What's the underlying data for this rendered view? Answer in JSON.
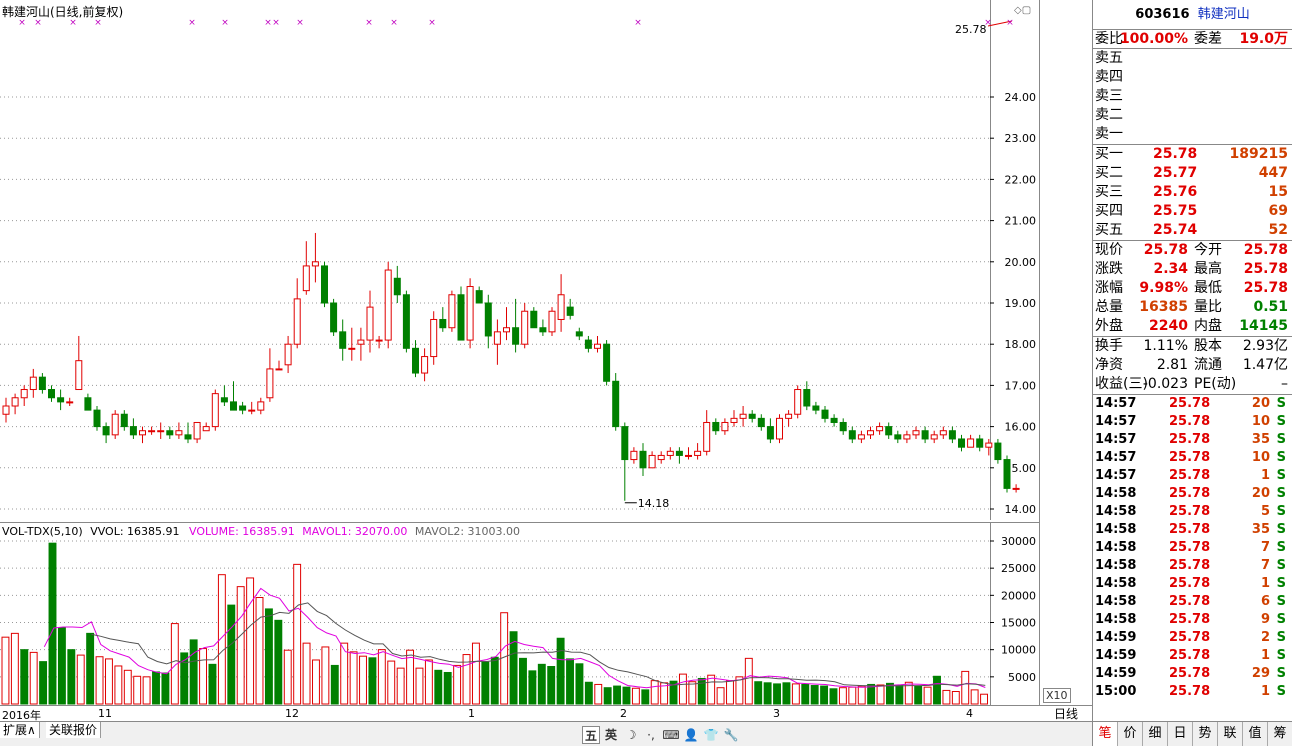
{
  "price_pane": {
    "title": "韩建河山(日线,前复权)",
    "high_label": "25.78",
    "low_label": "14.18",
    "y_ticks": [
      "24.00",
      "23.00",
      "22.00",
      "21.00",
      "20.00",
      "19.00",
      "18.00",
      "17.00",
      "16.00",
      "15.00",
      "14.00"
    ]
  },
  "volume_pane": {
    "indicator": "VOL-TDX(5,10)",
    "vvol": "VVOL: 16385.91",
    "volume": "VOLUME: 16385.91",
    "mavol1": "MAVOL1: 32070.00",
    "mavol2": "MAVOL2: 31003.00",
    "y_ticks": [
      "30000",
      "25000",
      "20000",
      "15000",
      "10000",
      "5000"
    ],
    "scale_label": "X10"
  },
  "x_axis": {
    "labels": [
      "2016年",
      "11",
      "12",
      "1",
      "2",
      "3",
      "4"
    ],
    "period": "日线"
  },
  "bottom_tabs": [
    "扩展∧",
    "关联报价"
  ],
  "toolbar_icons": [
    "五",
    "英",
    "☽",
    "·,",
    "⌨",
    "👤",
    "👕",
    "🔧"
  ],
  "quote": {
    "code": "603616",
    "name": "韩建河山",
    "weibi_label": "委比",
    "weibi_value": "100.00%",
    "weicha_label": "委差",
    "weicha_value": "19.0万",
    "sells": [
      {
        "label": "卖五",
        "price": "",
        "vol": ""
      },
      {
        "label": "卖四",
        "price": "",
        "vol": ""
      },
      {
        "label": "卖三",
        "price": "",
        "vol": ""
      },
      {
        "label": "卖二",
        "price": "",
        "vol": ""
      },
      {
        "label": "卖一",
        "price": "",
        "vol": ""
      }
    ],
    "buys": [
      {
        "label": "买一",
        "price": "25.78",
        "vol": "189215"
      },
      {
        "label": "买二",
        "price": "25.77",
        "vol": "447"
      },
      {
        "label": "买三",
        "price": "25.76",
        "vol": "15"
      },
      {
        "label": "买四",
        "price": "25.75",
        "vol": "69"
      },
      {
        "label": "买五",
        "price": "25.74",
        "vol": "52"
      }
    ],
    "stats": [
      {
        "l1": "现价",
        "v1": "25.78",
        "l2": "今开",
        "v2": "25.78",
        "c1": "red",
        "c2": "red"
      },
      {
        "l1": "涨跌",
        "v1": "2.34",
        "l2": "最高",
        "v2": "25.78",
        "c1": "red",
        "c2": "red"
      },
      {
        "l1": "涨幅",
        "v1": "9.98%",
        "l2": "最低",
        "v2": "25.78",
        "c1": "red",
        "c2": "red"
      },
      {
        "l1": "总量",
        "v1": "16385",
        "l2": "量比",
        "v2": "0.51",
        "c1": "orange",
        "c2": "green"
      },
      {
        "l1": "外盘",
        "v1": "2240",
        "l2": "内盘",
        "v2": "14145",
        "c1": "red",
        "c2": "green"
      }
    ],
    "fundamentals": [
      {
        "l1": "换手",
        "v1": "1.11%",
        "l2": "股本",
        "v2": "2.93亿"
      },
      {
        "l1": "净资",
        "v1": "2.81",
        "l2": "流通",
        "v2": "1.47亿"
      },
      {
        "l1": "收益(三)",
        "v1": "-0.023",
        "l2": "PE(动)",
        "v2": "–"
      }
    ],
    "ticks": [
      {
        "time": "14:57",
        "price": "25.78",
        "vol": "20",
        "flag": "S"
      },
      {
        "time": "14:57",
        "price": "25.78",
        "vol": "10",
        "flag": "S"
      },
      {
        "time": "14:57",
        "price": "25.78",
        "vol": "35",
        "flag": "S"
      },
      {
        "time": "14:57",
        "price": "25.78",
        "vol": "10",
        "flag": "S"
      },
      {
        "time": "14:57",
        "price": "25.78",
        "vol": "1",
        "flag": "S"
      },
      {
        "time": "14:58",
        "price": "25.78",
        "vol": "20",
        "flag": "S"
      },
      {
        "time": "14:58",
        "price": "25.78",
        "vol": "5",
        "flag": "S"
      },
      {
        "time": "14:58",
        "price": "25.78",
        "vol": "35",
        "flag": "S"
      },
      {
        "time": "14:58",
        "price": "25.78",
        "vol": "7",
        "flag": "S"
      },
      {
        "time": "14:58",
        "price": "25.78",
        "vol": "7",
        "flag": "S"
      },
      {
        "time": "14:58",
        "price": "25.78",
        "vol": "1",
        "flag": "S"
      },
      {
        "time": "14:58",
        "price": "25.78",
        "vol": "6",
        "flag": "S"
      },
      {
        "time": "14:58",
        "price": "25.78",
        "vol": "9",
        "flag": "S"
      },
      {
        "time": "14:59",
        "price": "25.78",
        "vol": "2",
        "flag": "S"
      },
      {
        "time": "14:59",
        "price": "25.78",
        "vol": "1",
        "flag": "S"
      },
      {
        "time": "14:59",
        "price": "25.78",
        "vol": "29",
        "flag": "S"
      },
      {
        "time": "15:00",
        "price": "25.78",
        "vol": "1",
        "flag": "S"
      }
    ],
    "tabs": [
      "笔",
      "价",
      "细",
      "日",
      "势",
      "联",
      "值",
      "筹"
    ]
  },
  "colors": {
    "up": "#e00000",
    "down": "#008000",
    "ma1": "#e000e0",
    "ma2": "#555555",
    "grid": "#999999"
  },
  "chart_data": {
    "type": "candlestick",
    "title": "韩建河山(日线,前复权)",
    "ylim": [
      14.0,
      24.0
    ],
    "x_labels": [
      "2016年",
      "11",
      "12",
      "1",
      "2",
      "3",
      "4"
    ],
    "candles": [
      [
        16.3,
        16.7,
        16.1,
        16.5
      ],
      [
        16.5,
        16.8,
        16.3,
        16.7
      ],
      [
        16.7,
        17.0,
        16.5,
        16.9
      ],
      [
        16.9,
        17.4,
        16.7,
        17.2
      ],
      [
        17.2,
        17.3,
        16.8,
        16.9
      ],
      [
        16.9,
        17.0,
        16.6,
        16.7
      ],
      [
        16.7,
        16.9,
        16.4,
        16.6
      ],
      [
        16.6,
        16.7,
        16.5,
        16.6
      ],
      [
        16.9,
        18.2,
        16.9,
        17.6
      ],
      [
        16.7,
        16.8,
        16.4,
        16.4
      ],
      [
        16.4,
        16.5,
        15.9,
        16.0
      ],
      [
        16.0,
        16.1,
        15.6,
        15.8
      ],
      [
        15.8,
        16.4,
        15.7,
        16.3
      ],
      [
        16.3,
        16.4,
        15.9,
        16.0
      ],
      [
        16.0,
        16.2,
        15.7,
        15.8
      ],
      [
        15.8,
        16.0,
        15.6,
        15.9
      ],
      [
        15.9,
        16.0,
        15.8,
        15.9
      ],
      [
        15.9,
        16.1,
        15.7,
        15.9
      ],
      [
        15.9,
        16.0,
        15.7,
        15.8
      ],
      [
        15.8,
        16.1,
        15.7,
        15.9
      ],
      [
        15.8,
        16.1,
        15.6,
        15.7
      ],
      [
        15.7,
        16.1,
        15.6,
        16.1
      ],
      [
        15.9,
        16.1,
        15.9,
        16.0
      ],
      [
        16.0,
        16.9,
        15.9,
        16.8
      ],
      [
        16.7,
        17.0,
        16.5,
        16.6
      ],
      [
        16.6,
        17.1,
        16.4,
        16.4
      ],
      [
        16.5,
        16.6,
        16.3,
        16.4
      ],
      [
        16.4,
        16.6,
        16.3,
        16.4
      ],
      [
        16.4,
        16.7,
        16.3,
        16.6
      ],
      [
        16.7,
        17.9,
        16.6,
        17.4
      ],
      [
        17.4,
        17.6,
        17.4,
        17.4
      ],
      [
        17.5,
        18.2,
        17.3,
        18.0
      ],
      [
        18.0,
        19.6,
        17.9,
        19.1
      ],
      [
        19.3,
        20.5,
        19.2,
        19.9
      ],
      [
        19.9,
        20.7,
        19.5,
        20.0
      ],
      [
        19.9,
        20.0,
        18.9,
        19.0
      ],
      [
        19.0,
        19.1,
        18.2,
        18.3
      ],
      [
        18.3,
        18.6,
        17.6,
        17.9
      ],
      [
        17.9,
        18.4,
        17.6,
        17.9
      ],
      [
        18.0,
        18.4,
        17.6,
        18.1
      ],
      [
        18.1,
        19.3,
        17.8,
        18.9
      ],
      [
        18.1,
        18.2,
        17.9,
        18.1
      ],
      [
        18.1,
        20.0,
        17.9,
        19.8
      ],
      [
        19.6,
        19.9,
        19.0,
        19.2
      ],
      [
        19.2,
        19.3,
        17.8,
        17.9
      ],
      [
        17.9,
        18.1,
        17.2,
        17.3
      ],
      [
        17.3,
        17.9,
        17.1,
        17.7
      ],
      [
        17.7,
        18.8,
        17.5,
        18.6
      ],
      [
        18.6,
        18.9,
        18.3,
        18.4
      ],
      [
        18.4,
        19.3,
        18.3,
        19.2
      ],
      [
        19.2,
        19.4,
        18.1,
        18.1
      ],
      [
        18.1,
        19.6,
        17.9,
        19.4
      ],
      [
        19.3,
        19.4,
        19.0,
        19.0
      ],
      [
        19.0,
        19.2,
        17.9,
        18.2
      ],
      [
        18.0,
        18.6,
        17.5,
        18.3
      ],
      [
        18.3,
        18.9,
        18.1,
        18.4
      ],
      [
        18.4,
        19.1,
        17.8,
        18.0
      ],
      [
        18.0,
        19.0,
        17.9,
        18.8
      ],
      [
        18.8,
        18.9,
        18.4,
        18.4
      ],
      [
        18.4,
        18.6,
        18.2,
        18.3
      ],
      [
        18.3,
        18.9,
        18.2,
        18.8
      ],
      [
        18.6,
        19.7,
        18.3,
        19.2
      ],
      [
        18.9,
        19.1,
        18.6,
        18.7
      ],
      [
        18.3,
        18.4,
        18.1,
        18.2
      ],
      [
        18.1,
        18.2,
        17.8,
        17.9
      ],
      [
        17.9,
        18.2,
        17.8,
        18.0
      ],
      [
        18.0,
        18.1,
        17.0,
        17.1
      ],
      [
        17.1,
        17.3,
        15.9,
        16.0
      ],
      [
        16.0,
        16.1,
        14.2,
        15.2
      ],
      [
        15.2,
        15.5,
        15.1,
        15.4
      ],
      [
        15.4,
        15.6,
        14.8,
        15.0
      ],
      [
        15.0,
        15.4,
        15.0,
        15.3
      ],
      [
        15.2,
        15.4,
        15.1,
        15.3
      ],
      [
        15.3,
        15.5,
        15.2,
        15.4
      ],
      [
        15.4,
        15.5,
        15.1,
        15.3
      ],
      [
        15.3,
        15.5,
        15.2,
        15.3
      ],
      [
        15.3,
        15.6,
        15.2,
        15.4
      ],
      [
        15.4,
        16.4,
        15.3,
        16.1
      ],
      [
        16.1,
        16.2,
        15.8,
        15.9
      ],
      [
        15.9,
        16.2,
        15.8,
        16.1
      ],
      [
        16.1,
        16.4,
        16.0,
        16.2
      ],
      [
        16.2,
        16.5,
        16.0,
        16.3
      ],
      [
        16.3,
        16.4,
        16.1,
        16.2
      ],
      [
        16.2,
        16.3,
        15.9,
        16.0
      ],
      [
        16.0,
        16.2,
        15.6,
        15.7
      ],
      [
        15.7,
        16.3,
        15.6,
        16.2
      ],
      [
        16.2,
        16.4,
        16.0,
        16.3
      ],
      [
        16.3,
        17.0,
        16.2,
        16.9
      ],
      [
        16.9,
        17.1,
        16.4,
        16.5
      ],
      [
        16.5,
        16.6,
        16.3,
        16.4
      ],
      [
        16.4,
        16.5,
        16.1,
        16.2
      ],
      [
        16.2,
        16.3,
        16.0,
        16.1
      ],
      [
        16.1,
        16.2,
        15.8,
        15.9
      ],
      [
        15.9,
        16.0,
        15.6,
        15.7
      ],
      [
        15.7,
        15.9,
        15.6,
        15.8
      ],
      [
        15.8,
        16.0,
        15.7,
        15.9
      ],
      [
        15.9,
        16.1,
        15.8,
        16.0
      ],
      [
        16.0,
        16.1,
        15.7,
        15.8
      ],
      [
        15.8,
        15.9,
        15.6,
        15.7
      ],
      [
        15.7,
        15.9,
        15.6,
        15.8
      ],
      [
        15.8,
        16.0,
        15.7,
        15.9
      ],
      [
        15.9,
        16.0,
        15.6,
        15.7
      ],
      [
        15.7,
        15.9,
        15.6,
        15.8
      ],
      [
        15.8,
        16.0,
        15.7,
        15.9
      ],
      [
        15.9,
        16.0,
        15.6,
        15.7
      ],
      [
        15.7,
        15.8,
        15.4,
        15.5
      ],
      [
        15.5,
        15.8,
        15.5,
        15.7
      ],
      [
        15.7,
        15.8,
        15.4,
        15.5
      ],
      [
        15.5,
        15.7,
        15.3,
        15.6
      ],
      [
        15.6,
        15.7,
        15.1,
        15.2
      ],
      [
        15.2,
        15.3,
        14.4,
        14.5
      ],
      [
        14.5,
        14.6,
        14.4,
        14.5
      ]
    ],
    "volumes": [
      [
        12300,
        1
      ],
      [
        13000,
        1
      ],
      [
        10000,
        0
      ],
      [
        9500,
        1
      ],
      [
        7800,
        0
      ],
      [
        29600,
        0
      ],
      [
        14000,
        0
      ],
      [
        10000,
        0
      ],
      [
        9000,
        1
      ],
      [
        13000,
        0
      ],
      [
        8700,
        1
      ],
      [
        8300,
        1
      ],
      [
        7000,
        1
      ],
      [
        6200,
        1
      ],
      [
        5100,
        1
      ],
      [
        5000,
        1
      ],
      [
        5900,
        0
      ],
      [
        5700,
        0
      ],
      [
        14800,
        1
      ],
      [
        9400,
        0
      ],
      [
        11800,
        0
      ],
      [
        10200,
        1
      ],
      [
        7300,
        0
      ],
      [
        23800,
        1
      ],
      [
        18200,
        0
      ],
      [
        21600,
        1
      ],
      [
        23200,
        1
      ],
      [
        19600,
        1
      ],
      [
        17500,
        0
      ],
      [
        15400,
        0
      ],
      [
        9900,
        1
      ],
      [
        25700,
        1
      ],
      [
        11200,
        1
      ],
      [
        8100,
        1
      ],
      [
        10500,
        1
      ],
      [
        7100,
        0
      ],
      [
        11200,
        1
      ],
      [
        9600,
        1
      ],
      [
        8800,
        1
      ],
      [
        8500,
        0
      ],
      [
        10000,
        1
      ],
      [
        7900,
        1
      ],
      [
        6600,
        1
      ],
      [
        9900,
        1
      ],
      [
        6600,
        1
      ],
      [
        8100,
        1
      ],
      [
        6200,
        0
      ],
      [
        5800,
        0
      ],
      [
        7100,
        1
      ],
      [
        9100,
        1
      ],
      [
        11200,
        1
      ],
      [
        7700,
        0
      ],
      [
        8600,
        0
      ],
      [
        16800,
        1
      ],
      [
        13300,
        0
      ],
      [
        8400,
        0
      ],
      [
        6100,
        0
      ],
      [
        7300,
        0
      ],
      [
        6900,
        0
      ],
      [
        12100,
        0
      ],
      [
        8300,
        0
      ],
      [
        7400,
        0
      ],
      [
        4000,
        0
      ],
      [
        3600,
        1
      ],
      [
        3000,
        0
      ],
      [
        3300,
        0
      ],
      [
        3100,
        0
      ],
      [
        2900,
        1
      ],
      [
        2600,
        0
      ],
      [
        4300,
        1
      ],
      [
        3900,
        1
      ],
      [
        4200,
        0
      ],
      [
        5500,
        1
      ],
      [
        4100,
        1
      ],
      [
        4700,
        0
      ],
      [
        5300,
        1
      ],
      [
        3000,
        1
      ],
      [
        4300,
        1
      ],
      [
        5000,
        1
      ],
      [
        8400,
        1
      ],
      [
        4100,
        0
      ],
      [
        3900,
        0
      ],
      [
        3700,
        0
      ],
      [
        3900,
        0
      ],
      [
        3700,
        1
      ],
      [
        3600,
        0
      ],
      [
        3400,
        0
      ],
      [
        3300,
        0
      ],
      [
        2800,
        0
      ],
      [
        3000,
        1
      ],
      [
        3100,
        1
      ],
      [
        3300,
        1
      ],
      [
        3600,
        0
      ],
      [
        3500,
        1
      ],
      [
        3800,
        0
      ],
      [
        3500,
        0
      ],
      [
        4000,
        1
      ],
      [
        3300,
        0
      ],
      [
        3100,
        1
      ],
      [
        5100,
        0
      ],
      [
        2500,
        1
      ],
      [
        2300,
        1
      ],
      [
        6000,
        1
      ],
      [
        2600,
        1
      ],
      [
        1800,
        1
      ]
    ]
  }
}
